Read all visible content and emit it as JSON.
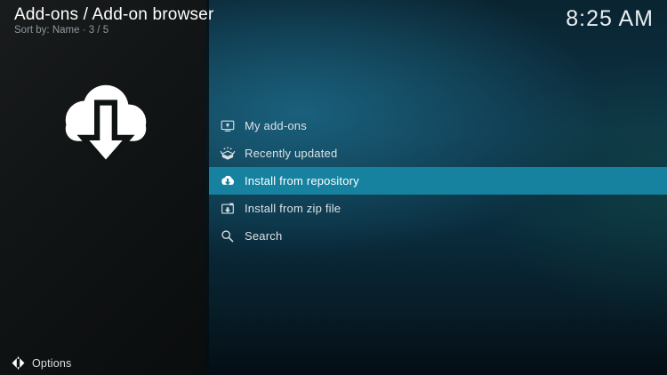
{
  "header": {
    "title": "Add-ons / Add-on browser",
    "subtitle": "Sort by: Name  ·  3 / 5",
    "clock": "8:25 AM"
  },
  "left_panel": {
    "artwork_icon": "cloud-download-icon"
  },
  "menu": {
    "items": [
      {
        "label": "My add-ons",
        "icon": "my-addons-monitor-icon",
        "selected": false
      },
      {
        "label": "Recently updated",
        "icon": "recently-updated-box-icon",
        "selected": false
      },
      {
        "label": "Install from repository",
        "icon": "cloud-download-icon",
        "selected": true
      },
      {
        "label": "Install from zip file",
        "icon": "zip-file-icon",
        "selected": false
      },
      {
        "label": "Search",
        "icon": "search-icon",
        "selected": false
      }
    ]
  },
  "footer": {
    "options_label": "Options",
    "options_icon": "options-icon"
  },
  "colors": {
    "highlight": "#1682a0",
    "left_panel_dark": "#101314",
    "background_teal": "#14506a",
    "text_primary": "#ffffff",
    "text_secondary": "#8f989c",
    "icon_light": "#d6dee1"
  }
}
